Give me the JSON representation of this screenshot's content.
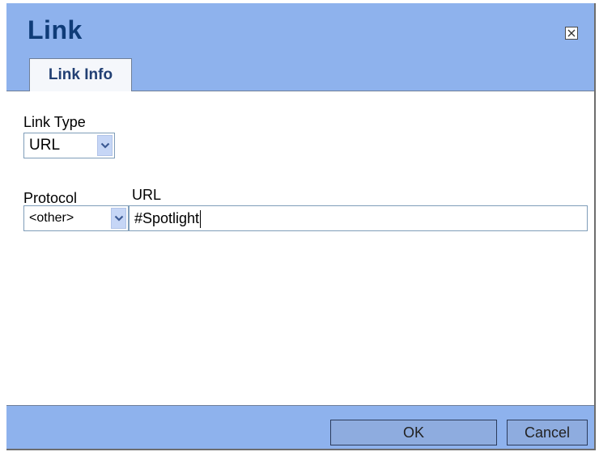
{
  "dialog": {
    "title": "Link",
    "close_icon": "close-box-icon"
  },
  "tabs": [
    {
      "label": "Link Info",
      "active": true
    }
  ],
  "form": {
    "link_type_label": "Link Type",
    "link_type_value": "URL",
    "protocol_label": "Protocol",
    "protocol_value": "<other>",
    "url_label": "URL",
    "url_value": "#Spotlight"
  },
  "footer": {
    "ok_label": "OK",
    "cancel_label": "Cancel"
  },
  "colors": {
    "dialog_bg": "#8eb2ed",
    "title_text": "#0f3c78",
    "button_bg": "#8eacdf"
  }
}
